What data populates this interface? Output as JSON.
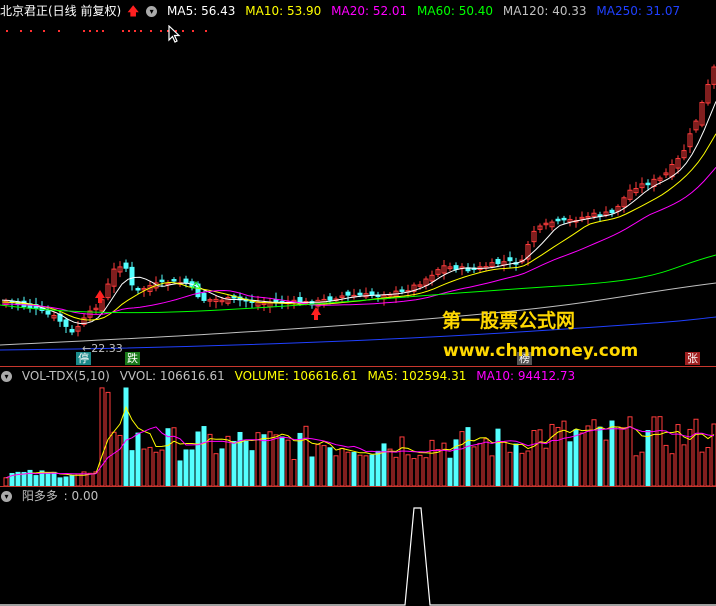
{
  "main_header": {
    "title": "北京君正(日线 前复权)",
    "ma5": "MA5: 56.43",
    "ma10": "MA10: 53.90",
    "ma20": "MA20: 52.01",
    "ma60": "MA60: 50.40",
    "ma120": "MA120: 40.33",
    "ma250": "MA250: 31.07"
  },
  "main_chart": {
    "low_label": "←22.33",
    "tag_ting": "停",
    "tag_die": "跌",
    "tag_bang": "榜",
    "tag_zhang": "张"
  },
  "watermark": {
    "line1": "第一股票公式网",
    "line2": "www.chnmoney.com"
  },
  "volume_header": {
    "name": "VOL-TDX(5,10)",
    "vvol": "VVOL: 106616.61",
    "volume": "VOLUME: 106616.61",
    "ma5": "MA5: 102594.31",
    "ma10": "MA10: 94412.73"
  },
  "indicator_header": {
    "name": "阳多多",
    "value": ": 0.00"
  },
  "colors": {
    "up": "#ff3c3c",
    "down": "#54ffff",
    "ma5": "#ffffff",
    "ma10": "#ffff00",
    "ma20": "#ff00ff",
    "ma60": "#00ff00",
    "ma120": "#c0c0c0",
    "ma250": "#2040ff",
    "separator": "#c8372d"
  }
}
